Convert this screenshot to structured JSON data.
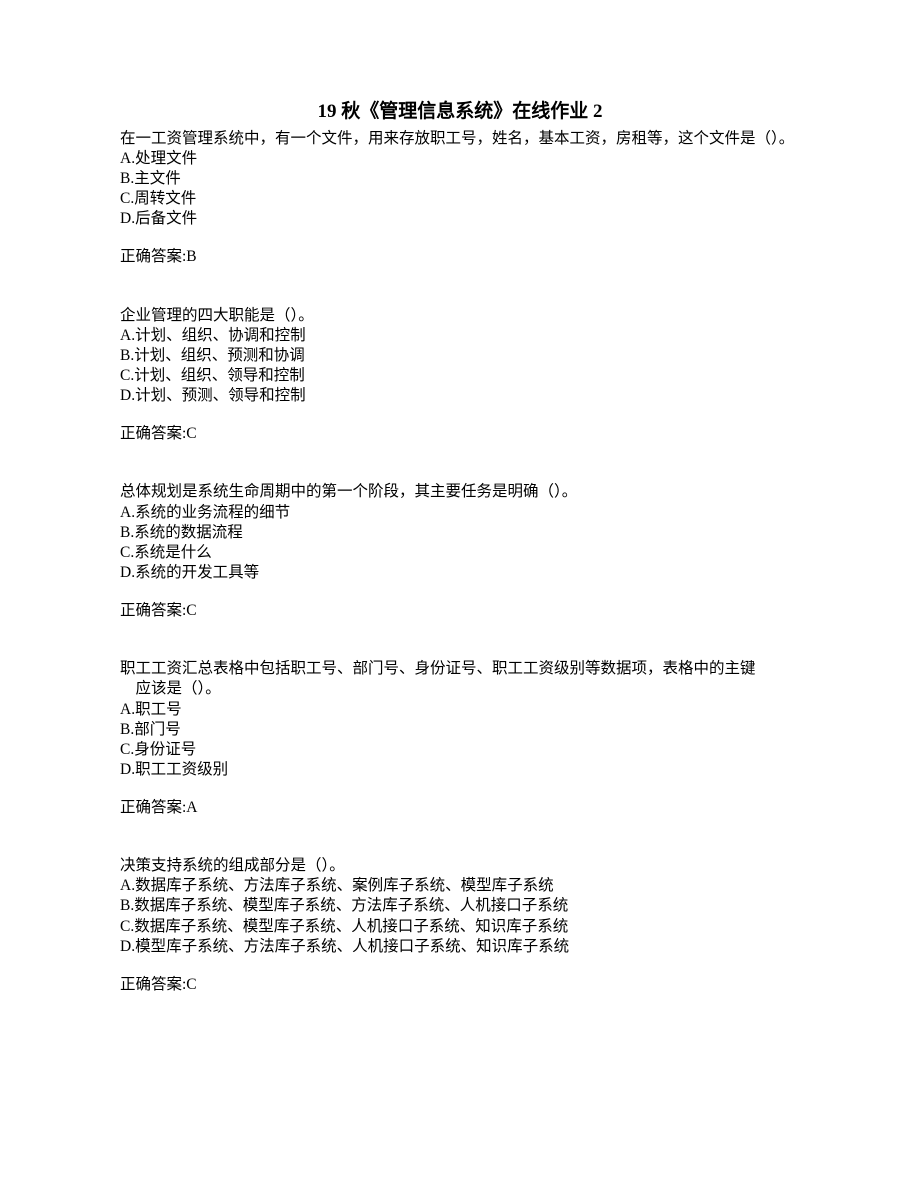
{
  "title": "19 秋《管理信息系统》在线作业 2",
  "questions": [
    {
      "text": "在一工资管理系统中，有一个文件，用来存放职工号，姓名，基本工资，房租等，这个文件是（）。",
      "options": {
        "a": "A.处理文件",
        "b": "B.主文件",
        "c": "C.周转文件",
        "d": "D.后备文件"
      },
      "answer": "正确答案:B"
    },
    {
      "text": "企业管理的四大职能是（）。",
      "options": {
        "a": "A.计划、组织、协调和控制",
        "b": "B.计划、组织、预测和协调",
        "c": "C.计划、组织、领导和控制",
        "d": "D.计划、预测、领导和控制"
      },
      "answer": "正确答案:C"
    },
    {
      "text": "总体规划是系统生命周期中的第一个阶段，其主要任务是明确（）。",
      "options": {
        "a": "A.系统的业务流程的细节",
        "b": "B.系统的数据流程",
        "c": "C.系统是什么",
        "d": "D.系统的开发工具等"
      },
      "answer": "正确答案:C"
    },
    {
      "text_line1": "职工工资汇总表格中包括职工号、部门号、身份证号、职工工资级别等数据项，表格中的主键",
      "text_line2": "应该是（）。",
      "options": {
        "a": "A.职工号",
        "b": "B.部门号",
        "c": "C.身份证号",
        "d": "D.职工工资级别"
      },
      "answer": "正确答案:A"
    },
    {
      "text": "决策支持系统的组成部分是（）。",
      "options": {
        "a": "A.数据库子系统、方法库子系统、案例库子系统、模型库子系统",
        "b": "B.数据库子系统、模型库子系统、方法库子系统、人机接口子系统",
        "c": "C.数据库子系统、模型库子系统、人机接口子系统、知识库子系统",
        "d": "D.模型库子系统、方法库子系统、人机接口子系统、知识库子系统"
      },
      "answer": "正确答案:C"
    }
  ]
}
